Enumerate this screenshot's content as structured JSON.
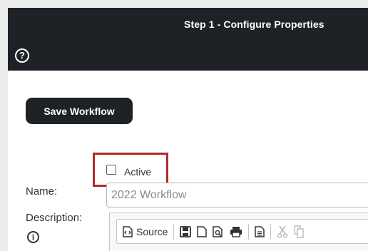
{
  "header": {
    "title": "Step 1 - Configure Properties",
    "help_icon": "question-circle-icon",
    "background": "#1e2226"
  },
  "actions": {
    "save_label": "Save Workflow"
  },
  "form": {
    "active_label": "Active",
    "active_checked": false,
    "name_label": "Name:",
    "name_value": "2022 Workflow",
    "description_label": "Description:",
    "description_info_icon": "info-circle-icon"
  },
  "editor_toolbar": {
    "source_label": "Source",
    "buttons": [
      "source-icon",
      "save-icon",
      "new-page-icon",
      "preview-icon",
      "print-icon",
      "templates-icon",
      "cut-icon",
      "copy-icon"
    ],
    "disabled": [
      "cut-icon",
      "copy-icon"
    ]
  },
  "colors": {
    "highlight": "#b22a2a",
    "button_dark": "#1e2226"
  }
}
